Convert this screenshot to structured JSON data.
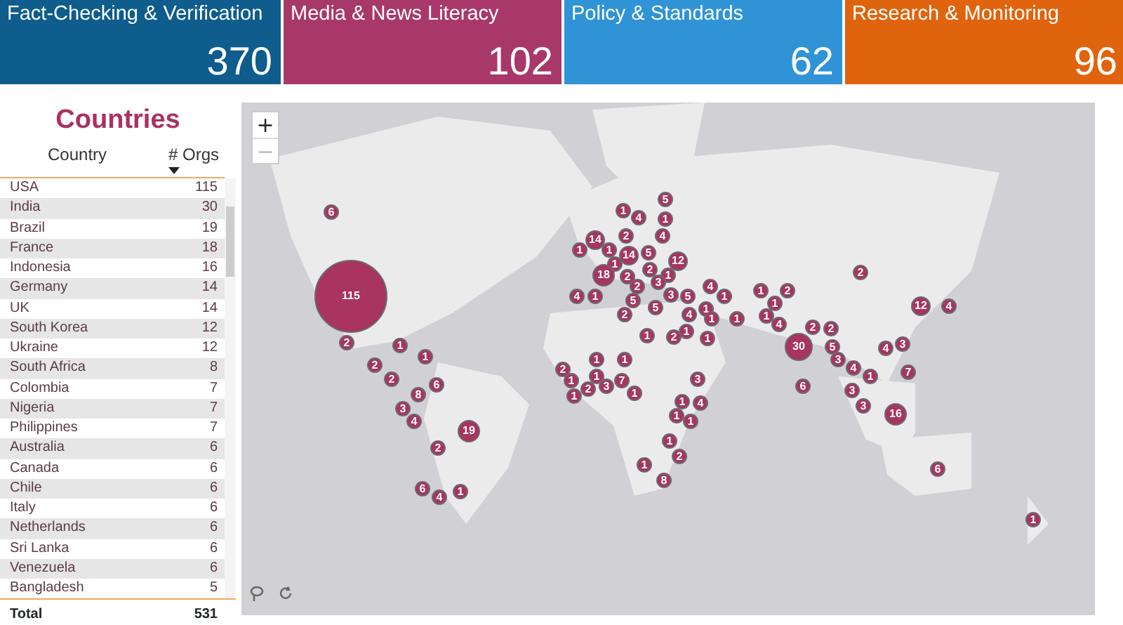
{
  "kpis": [
    {
      "label": "Fact-Checking & Verification",
      "value": "370",
      "color": "#0e5d8c"
    },
    {
      "label": "Media & News Literacy",
      "value": "102",
      "color": "#a8386a"
    },
    {
      "label": "Policy & Standards",
      "value": "62",
      "color": "#2f93d5"
    },
    {
      "label": "Research & Monitoring",
      "value": "96",
      "color": "#e0640d"
    }
  ],
  "countries": {
    "title": "Countries",
    "columns": [
      {
        "label": "Country",
        "sorted": false
      },
      {
        "label": "# Orgs",
        "sorted": true
      }
    ],
    "rows": [
      {
        "country": "USA",
        "orgs": "115"
      },
      {
        "country": "India",
        "orgs": "30"
      },
      {
        "country": "Brazil",
        "orgs": "19"
      },
      {
        "country": "France",
        "orgs": "18"
      },
      {
        "country": "Indonesia",
        "orgs": "16"
      },
      {
        "country": "Germany",
        "orgs": "14"
      },
      {
        "country": "UK",
        "orgs": "14"
      },
      {
        "country": "South Korea",
        "orgs": "12"
      },
      {
        "country": "Ukraine",
        "orgs": "12"
      },
      {
        "country": "South Africa",
        "orgs": "8"
      },
      {
        "country": "Colombia",
        "orgs": "7"
      },
      {
        "country": "Nigeria",
        "orgs": "7"
      },
      {
        "country": "Philippines",
        "orgs": "7"
      },
      {
        "country": "Australia",
        "orgs": "6"
      },
      {
        "country": "Canada",
        "orgs": "6"
      },
      {
        "country": "Chile",
        "orgs": "6"
      },
      {
        "country": "Italy",
        "orgs": "6"
      },
      {
        "country": "Netherlands",
        "orgs": "6"
      },
      {
        "country": "Sri Lanka",
        "orgs": "6"
      },
      {
        "country": "Venezuela",
        "orgs": "6"
      },
      {
        "country": "Bangladesh",
        "orgs": "5"
      }
    ],
    "total": {
      "label": "Total",
      "value": "531"
    }
  },
  "map": {
    "zoom_in": {
      "label": "+",
      "disabled": false
    },
    "zoom_out": {
      "label": "−",
      "disabled": true
    },
    "markers": [
      {
        "count": "6"
      },
      {
        "count": "115"
      },
      {
        "count": "2"
      },
      {
        "count": "1"
      },
      {
        "count": "1"
      },
      {
        "count": "2"
      },
      {
        "count": "2"
      },
      {
        "count": "6"
      },
      {
        "count": "8"
      },
      {
        "count": "3"
      },
      {
        "count": "4"
      },
      {
        "count": "19"
      },
      {
        "count": "2"
      },
      {
        "count": "6"
      },
      {
        "count": "4"
      },
      {
        "count": "1"
      },
      {
        "count": "5"
      },
      {
        "count": "1"
      },
      {
        "count": "4"
      },
      {
        "count": "1"
      },
      {
        "count": "4"
      },
      {
        "count": "14"
      },
      {
        "count": "2"
      },
      {
        "count": "1"
      },
      {
        "count": "1"
      },
      {
        "count": "14"
      },
      {
        "count": "5"
      },
      {
        "count": "1"
      },
      {
        "count": "2"
      },
      {
        "count": "18"
      },
      {
        "count": "2"
      },
      {
        "count": "12"
      },
      {
        "count": "1"
      },
      {
        "count": "2"
      },
      {
        "count": "3"
      },
      {
        "count": "5"
      },
      {
        "count": "3"
      },
      {
        "count": "5"
      },
      {
        "count": "4"
      },
      {
        "count": "1"
      },
      {
        "count": "5"
      },
      {
        "count": "4"
      },
      {
        "count": "1"
      },
      {
        "count": "1"
      },
      {
        "count": "2"
      },
      {
        "count": "1"
      },
      {
        "count": "2"
      },
      {
        "count": "4"
      },
      {
        "count": "1"
      },
      {
        "count": "1"
      },
      {
        "count": "1"
      },
      {
        "count": "1"
      },
      {
        "count": "1"
      },
      {
        "count": "4"
      },
      {
        "count": "1"
      },
      {
        "count": "2"
      },
      {
        "count": "1"
      },
      {
        "count": "2"
      },
      {
        "count": "2"
      },
      {
        "count": "30"
      },
      {
        "count": "5"
      },
      {
        "count": "6"
      },
      {
        "count": "2"
      },
      {
        "count": "1"
      },
      {
        "count": "1"
      },
      {
        "count": "1"
      },
      {
        "count": "1"
      },
      {
        "count": "7"
      },
      {
        "count": "2"
      },
      {
        "count": "3"
      },
      {
        "count": "1"
      },
      {
        "count": "1"
      },
      {
        "count": "3"
      },
      {
        "count": "1"
      },
      {
        "count": "4"
      },
      {
        "count": "1"
      },
      {
        "count": "1"
      },
      {
        "count": "1"
      },
      {
        "count": "2"
      },
      {
        "count": "1"
      },
      {
        "count": "8"
      },
      {
        "count": "2"
      },
      {
        "count": "12"
      },
      {
        "count": "4"
      },
      {
        "count": "4"
      },
      {
        "count": "3"
      },
      {
        "count": "3"
      },
      {
        "count": "4"
      },
      {
        "count": "1"
      },
      {
        "count": "7"
      },
      {
        "count": "3"
      },
      {
        "count": "3"
      },
      {
        "count": "16"
      },
      {
        "count": "6"
      },
      {
        "count": "1"
      }
    ]
  }
}
